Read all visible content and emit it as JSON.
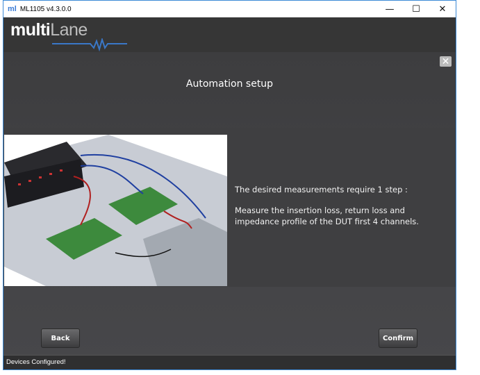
{
  "window": {
    "title": "ML1105 v4.3.0.0",
    "app_icon": "ml",
    "minimize": "—",
    "maximize": "☐",
    "close": "✕"
  },
  "logo": {
    "text_a": "multi",
    "text_b": "Lane"
  },
  "dialog": {
    "heading": "Automation setup",
    "close": "✕",
    "step_text": "The desired measurements require 1 step :",
    "description": "Measure the insertion loss, return loss and impedance profile of the DUT first 4 channels."
  },
  "buttons": {
    "back": "Back",
    "confirm": "Confirm"
  },
  "status": "Devices Configured!"
}
